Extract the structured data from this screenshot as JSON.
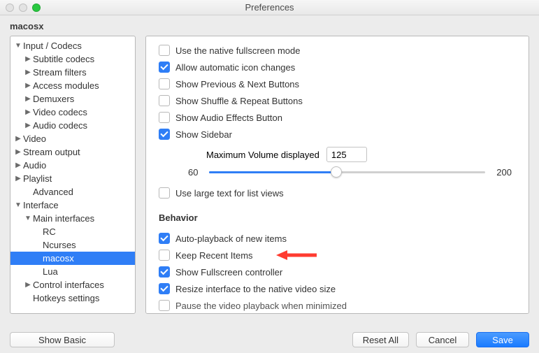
{
  "window": {
    "title": "Preferences"
  },
  "breadcrumb": "macosx",
  "sidebar": {
    "items": [
      {
        "label": "Input / Codecs",
        "tri": "down",
        "depth": 0
      },
      {
        "label": "Subtitle codecs",
        "tri": "right",
        "depth": 1
      },
      {
        "label": "Stream filters",
        "tri": "right",
        "depth": 1
      },
      {
        "label": "Access modules",
        "tri": "right",
        "depth": 1
      },
      {
        "label": "Demuxers",
        "tri": "right",
        "depth": 1
      },
      {
        "label": "Video codecs",
        "tri": "right",
        "depth": 1
      },
      {
        "label": "Audio codecs",
        "tri": "right",
        "depth": 1
      },
      {
        "label": "Video",
        "tri": "right",
        "depth": 0
      },
      {
        "label": "Stream output",
        "tri": "right",
        "depth": 0
      },
      {
        "label": "Audio",
        "tri": "right",
        "depth": 0
      },
      {
        "label": "Playlist",
        "tri": "right",
        "depth": 0
      },
      {
        "label": "Advanced",
        "tri": "none",
        "depth": 1
      },
      {
        "label": "Interface",
        "tri": "down",
        "depth": 0
      },
      {
        "label": "Main interfaces",
        "tri": "down",
        "depth": 1
      },
      {
        "label": "RC",
        "tri": "none",
        "depth": 2
      },
      {
        "label": "Ncurses",
        "tri": "none",
        "depth": 2
      },
      {
        "label": "macosx",
        "tri": "none",
        "depth": 2,
        "selected": true
      },
      {
        "label": "Lua",
        "tri": "none",
        "depth": 2
      },
      {
        "label": "Control interfaces",
        "tri": "right",
        "depth": 1
      },
      {
        "label": "Hotkeys settings",
        "tri": "none",
        "depth": 1
      }
    ]
  },
  "settings": {
    "group1": [
      {
        "label": "Use the native fullscreen mode",
        "checked": false
      },
      {
        "label": "Allow automatic icon changes",
        "checked": true
      },
      {
        "label": "Show Previous & Next Buttons",
        "checked": false
      },
      {
        "label": "Show Shuffle & Repeat Buttons",
        "checked": false
      },
      {
        "label": "Show Audio Effects Button",
        "checked": false
      },
      {
        "label": "Show Sidebar",
        "checked": true
      }
    ],
    "volume": {
      "label": "Maximum Volume displayed",
      "value": "125",
      "min": "60",
      "max": "200",
      "pct": 46
    },
    "large_text": {
      "label": "Use large text for list views",
      "checked": false
    },
    "behavior_title": "Behavior",
    "behavior": [
      {
        "label": "Auto-playback of new items",
        "checked": true
      },
      {
        "label": "Keep Recent Items",
        "checked": false,
        "arrow": true
      },
      {
        "label": "Show Fullscreen controller",
        "checked": true
      },
      {
        "label": "Resize interface to the native video size",
        "checked": true
      },
      {
        "label": "Pause the video playback when minimized",
        "checked": false,
        "cut": true
      }
    ]
  },
  "footer": {
    "show_basic": "Show Basic",
    "reset": "Reset All",
    "cancel": "Cancel",
    "save": "Save"
  }
}
